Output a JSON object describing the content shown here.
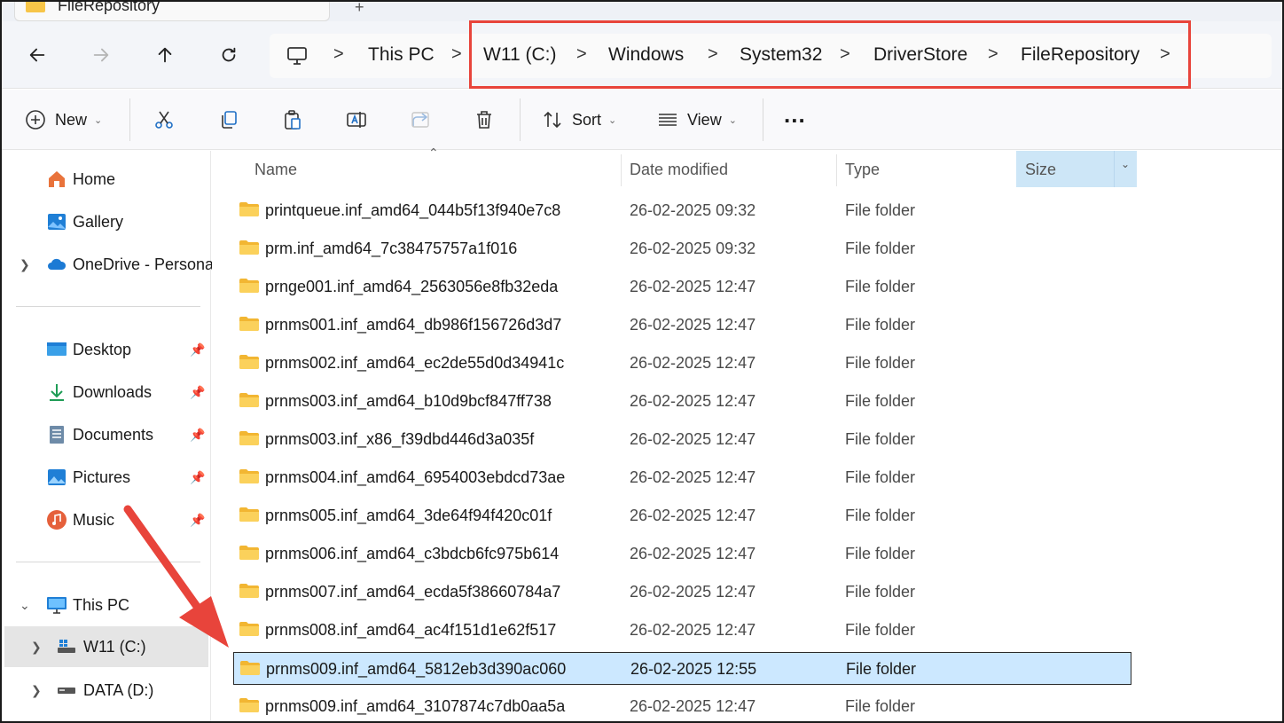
{
  "tab": {
    "title": "FileRepository",
    "new_tab": "+"
  },
  "nav": {
    "back": "back-arrow-icon",
    "forward": "forward-arrow-icon",
    "up": "up-arrow-icon",
    "refresh": "refresh-icon"
  },
  "address": {
    "crumbs": [
      "This PC",
      "W11 (C:)",
      "Windows",
      "System32",
      "DriverStore",
      "FileRepository"
    ],
    "separator": ">"
  },
  "toolbar": {
    "new_label": "New",
    "sort_label": "Sort",
    "view_label": "View",
    "more_label": "..."
  },
  "sidebar": {
    "quick": [
      {
        "label": "Home"
      },
      {
        "label": "Gallery"
      },
      {
        "label": "OneDrive - Persona"
      }
    ],
    "pinned": [
      {
        "label": "Desktop"
      },
      {
        "label": "Downloads"
      },
      {
        "label": "Documents"
      },
      {
        "label": "Pictures"
      },
      {
        "label": "Music"
      }
    ],
    "devices": [
      {
        "label": "This PC"
      },
      {
        "label": "W11 (C:)"
      },
      {
        "label": "DATA (D:)"
      }
    ]
  },
  "columns": {
    "name": "Name",
    "date": "Date modified",
    "type": "Type",
    "size": "Size"
  },
  "files": [
    {
      "name": "printqueue.inf_amd64_044b5f13f940e7c8",
      "date": "26-02-2025 09:32",
      "type": "File folder"
    },
    {
      "name": "prm.inf_amd64_7c38475757a1f016",
      "date": "26-02-2025 09:32",
      "type": "File folder"
    },
    {
      "name": "prnge001.inf_amd64_2563056e8fb32eda",
      "date": "26-02-2025 12:47",
      "type": "File folder"
    },
    {
      "name": "prnms001.inf_amd64_db986f156726d3d7",
      "date": "26-02-2025 12:47",
      "type": "File folder"
    },
    {
      "name": "prnms002.inf_amd64_ec2de55d0d34941c",
      "date": "26-02-2025 12:47",
      "type": "File folder"
    },
    {
      "name": "prnms003.inf_amd64_b10d9bcf847ff738",
      "date": "26-02-2025 12:47",
      "type": "File folder"
    },
    {
      "name": "prnms003.inf_x86_f39dbd446d3a035f",
      "date": "26-02-2025 12:47",
      "type": "File folder"
    },
    {
      "name": "prnms004.inf_amd64_6954003ebdcd73ae",
      "date": "26-02-2025 12:47",
      "type": "File folder"
    },
    {
      "name": "prnms005.inf_amd64_3de64f94f420c01f",
      "date": "26-02-2025 12:47",
      "type": "File folder"
    },
    {
      "name": "prnms006.inf_amd64_c3bdcb6fc975b614",
      "date": "26-02-2025 12:47",
      "type": "File folder"
    },
    {
      "name": "prnms007.inf_amd64_ecda5f38660784a7",
      "date": "26-02-2025 12:47",
      "type": "File folder"
    },
    {
      "name": "prnms008.inf_amd64_ac4f151d1e62f517",
      "date": "26-02-2025 12:47",
      "type": "File folder"
    },
    {
      "name": "prnms009.inf_amd64_5812eb3d390ac060",
      "date": "26-02-2025 12:55",
      "type": "File folder"
    },
    {
      "name": "prnms009.inf_amd64_3107874c7db0aa5a",
      "date": "26-02-2025 12:47",
      "type": "File folder"
    }
  ],
  "colors": {
    "accent": "#e8443b",
    "selection": "#cce8ff",
    "folder": "#f7c548"
  }
}
